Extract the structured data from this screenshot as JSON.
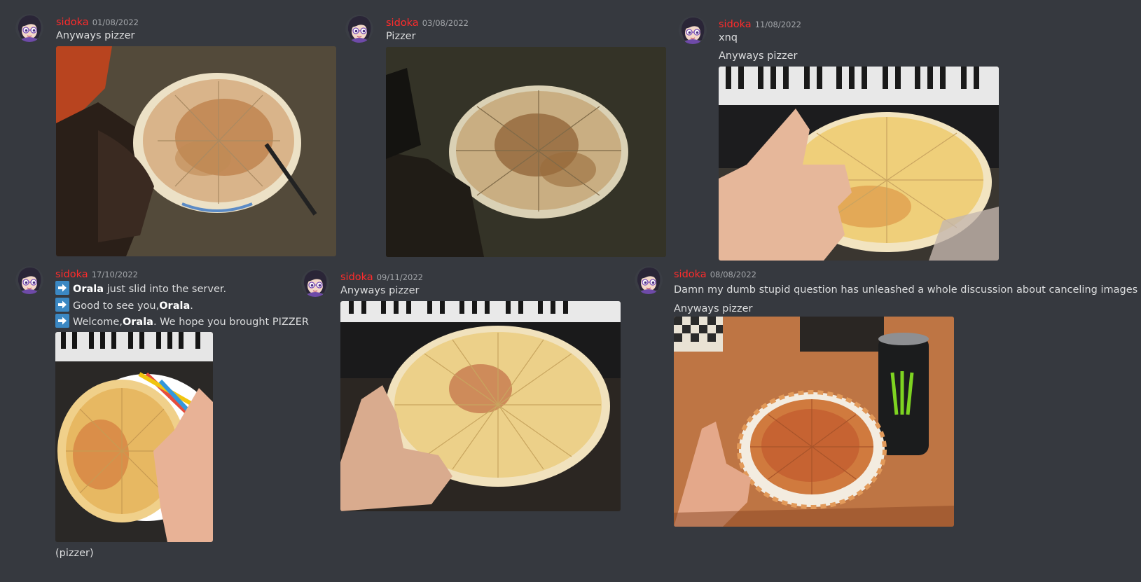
{
  "colors": {
    "background": "#36393f",
    "author": "#ff2b2b",
    "timestamp": "#a3a6aa",
    "text": "#dcddde",
    "join_arrow": "#3b88c3"
  },
  "messages": [
    {
      "author": "sidoka",
      "timestamp": "01/08/2022",
      "lines": [
        "Anyways pizzer"
      ],
      "image": "pizza-photo-thumbs-up-knife"
    },
    {
      "author": "sidoka",
      "timestamp": "03/08/2022",
      "lines": [
        "Pizzer"
      ],
      "image": "pizza-photo-dark-table"
    },
    {
      "author": "sidoka",
      "timestamp": "11/08/2022",
      "lines": [
        "xnq",
        "Anyways pizzer"
      ],
      "image": "pizza-photo-keyboard-thumbs-up"
    },
    {
      "author": "sidoka",
      "timestamp": "17/10/2022",
      "system": [
        {
          "pre": "",
          "name": "Orala",
          "post": " just slid into the server."
        },
        {
          "pre": "Good to see you,",
          "name": "Orala",
          "post": "."
        },
        {
          "pre": "Welcome,",
          "name": "Orala",
          "post": ". We hope you brought PIZZER"
        }
      ],
      "image": "pizza-photo-rainbow-plate",
      "caption": "(pizzer)"
    },
    {
      "author": "sidoka",
      "timestamp": "09/11/2022",
      "lines": [
        "Anyways pizzer"
      ],
      "image": "pizza-photo-keyboard-sliced"
    },
    {
      "author": "sidoka",
      "timestamp": "08/08/2022",
      "lines": [
        "Damn my dumb stupid question has unleashed a whole discussion about canceling images",
        "Anyways pizzer"
      ],
      "image": "pizza-photo-monster-can"
    }
  ]
}
